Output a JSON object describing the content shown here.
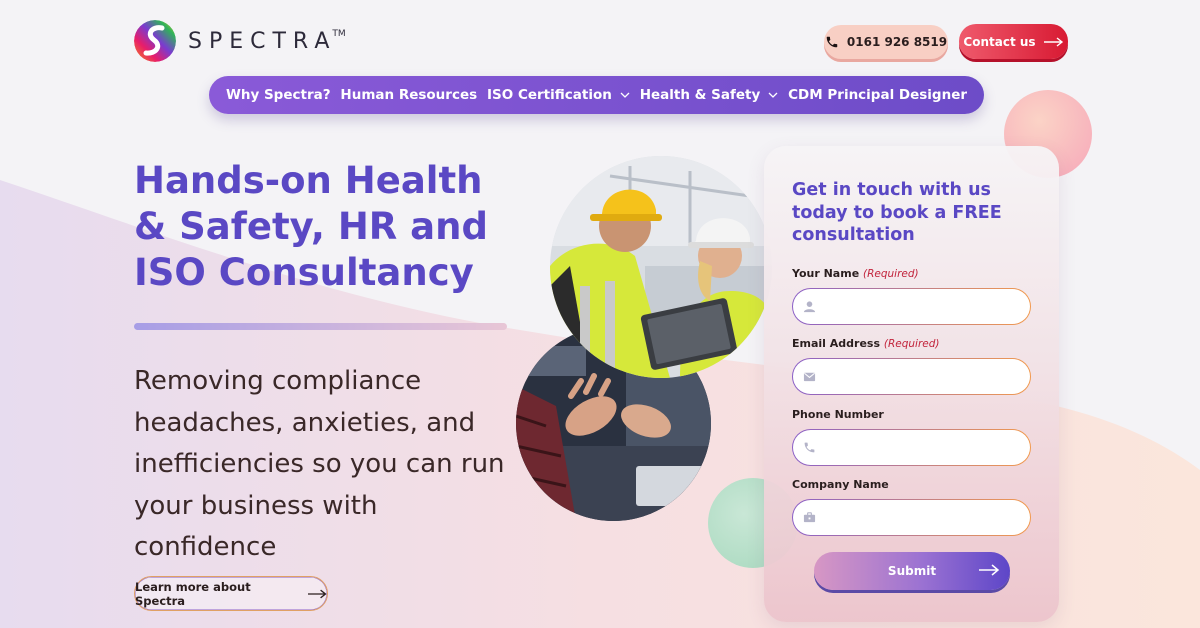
{
  "brand": {
    "name": "SPECTRA",
    "trademark": "TM"
  },
  "header": {
    "phone": "0161 926 8519",
    "contact_label": "Contact us"
  },
  "nav": {
    "items": [
      {
        "label": "Why Spectra?",
        "has_dropdown": false
      },
      {
        "label": "Human Resources",
        "has_dropdown": false
      },
      {
        "label": "ISO Certification",
        "has_dropdown": true
      },
      {
        "label": "Health & Safety",
        "has_dropdown": true
      },
      {
        "label": "CDM Principal Designer",
        "has_dropdown": false
      }
    ]
  },
  "hero": {
    "title": "Hands-on Health & Safety, HR and ISO Consultancy",
    "subtitle": "Removing compliance headaches, anxieties, and inefficiencies so you can run your business with confidence",
    "learn_more_label": "Learn more about Spectra"
  },
  "form": {
    "heading": "Get in touch with us today to book a FREE consultation",
    "required_text": "(Required)",
    "fields": [
      {
        "label": "Your Name",
        "required": true,
        "icon": "user-icon",
        "value": ""
      },
      {
        "label": "Email Address",
        "required": true,
        "icon": "envelope-icon",
        "value": ""
      },
      {
        "label": "Phone Number",
        "required": false,
        "icon": "phone-icon",
        "value": ""
      },
      {
        "label": "Company Name",
        "required": false,
        "icon": "briefcase-icon",
        "value": ""
      }
    ],
    "submit_label": "Submit"
  },
  "colors": {
    "brand_purple": "#5a48c4",
    "nav_purple": "#7b52d0",
    "contact_red": "#e02a40",
    "phone_pink": "#f8cfc4",
    "required_red": "#c2243c"
  }
}
